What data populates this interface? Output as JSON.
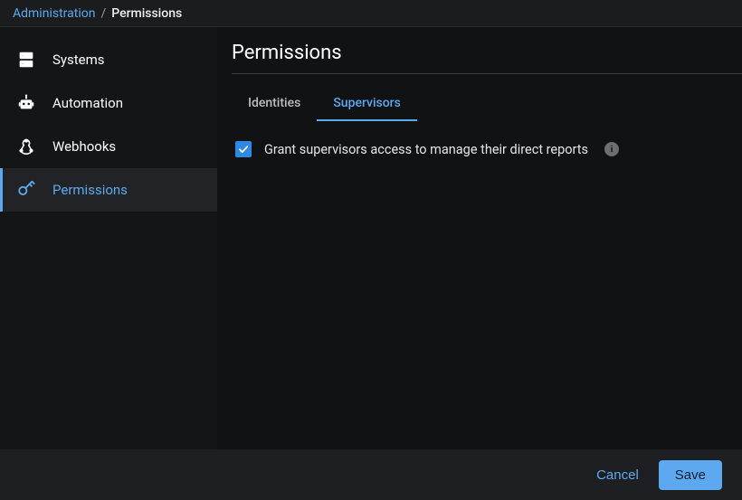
{
  "breadcrumb": {
    "root": "Administration",
    "separator": "/",
    "current": "Permissions"
  },
  "sidebar": {
    "items": [
      {
        "label": "Systems",
        "icon": "systems-icon",
        "active": false
      },
      {
        "label": "Automation",
        "icon": "automation-icon",
        "active": false
      },
      {
        "label": "Webhooks",
        "icon": "webhooks-icon",
        "active": false
      },
      {
        "label": "Permissions",
        "icon": "permissions-icon",
        "active": true
      }
    ]
  },
  "main": {
    "title": "Permissions",
    "tabs": [
      {
        "label": "Identities",
        "active": false
      },
      {
        "label": "Supervisors",
        "active": true
      }
    ],
    "supervisors": {
      "grant_checkbox": {
        "checked": true,
        "label": "Grant supervisors access to manage their direct reports"
      }
    }
  },
  "footer": {
    "cancel": "Cancel",
    "save": "Save"
  }
}
